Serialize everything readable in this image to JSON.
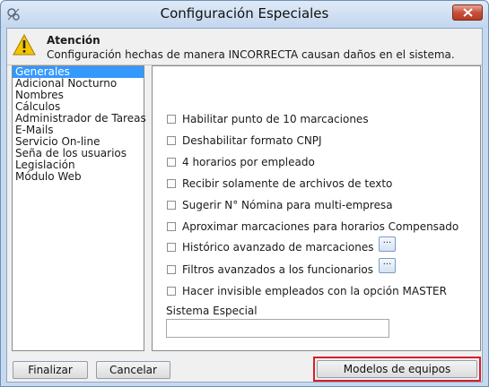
{
  "window": {
    "title": "Configuración Especiales"
  },
  "warning": {
    "title": "Atención",
    "text": "Configuración hechas de manera INCORRECTA causan daños en el sistema."
  },
  "categories": [
    {
      "label": "Generales",
      "selected": true
    },
    {
      "label": "Adicional Nocturno",
      "selected": false
    },
    {
      "label": "Nombres",
      "selected": false
    },
    {
      "label": "Cálculos",
      "selected": false
    },
    {
      "label": "Administrador de Tareas",
      "selected": false
    },
    {
      "label": "E-Mails",
      "selected": false
    },
    {
      "label": "Servicio On-line",
      "selected": false
    },
    {
      "label": "Seña de los usuarios",
      "selected": false
    },
    {
      "label": "Legislación",
      "selected": false
    },
    {
      "label": "Módulo Web",
      "selected": false
    }
  ],
  "options": [
    {
      "label": "Habilitar punto de 10 marcaciones",
      "checked": false
    },
    {
      "label": "Deshabilitar formato CNPJ",
      "checked": false
    },
    {
      "label": "4 horarios por empleado",
      "checked": false
    },
    {
      "label": "Recibir solamente de archivos de texto",
      "checked": false
    },
    {
      "label": "Sugerir N° Nómina para multi-empresa",
      "checked": false
    },
    {
      "label": "Aproximar marcaciones para horarios Compensado",
      "checked": false
    },
    {
      "label": "Histórico avanzado de marcaciones",
      "checked": false
    },
    {
      "label": "Filtros avanzados a los funcionarios",
      "checked": false
    },
    {
      "label": "Hacer invisible empleados con la opción MASTER",
      "checked": false
    }
  ],
  "ellipsis_label": "...",
  "system": {
    "label": "Sistema Especial",
    "value": ""
  },
  "buttons": {
    "finalize": "Finalizar",
    "cancel": "Cancelar",
    "models": "Modelos de equipos"
  },
  "colors": {
    "selection": "#3399ff",
    "highlight": "#d81e2a",
    "close": "#c7503a"
  }
}
